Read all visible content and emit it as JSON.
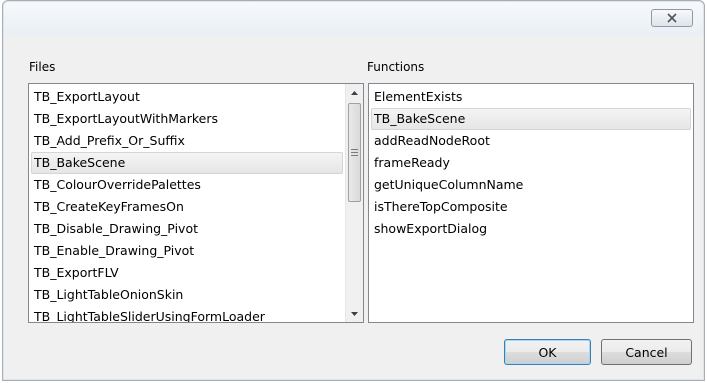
{
  "files": {
    "label": "Files",
    "selected_index": 3,
    "items": [
      "TB_ExportLayout",
      "TB_ExportLayoutWithMarkers",
      "TB_Add_Prefix_Or_Suffix",
      "TB_BakeScene",
      "TB_ColourOverridePalettes",
      "TB_CreateKeyFramesOn",
      "TB_Disable_Drawing_Pivot",
      "TB_Enable_Drawing_Pivot",
      "TB_ExportFLV",
      "TB_LightTableOnionSkin",
      "TB_LightTableSliderUsingFormLoader"
    ]
  },
  "functions": {
    "label": "Functions",
    "selected_index": 1,
    "items": [
      "ElementExists",
      "TB_BakeScene",
      "addReadNodeRoot",
      "frameReady",
      "getUniqueColumnName",
      "isThereTopComposite",
      "showExportDialog"
    ]
  },
  "buttons": {
    "ok": "OK",
    "cancel": "Cancel"
  },
  "icons": {
    "close": "close-icon",
    "scroll_up": "scroll-up-arrow-icon",
    "scroll_down": "scroll-down-arrow-icon",
    "thumb_grip": "scrollbar-grip-icon"
  }
}
